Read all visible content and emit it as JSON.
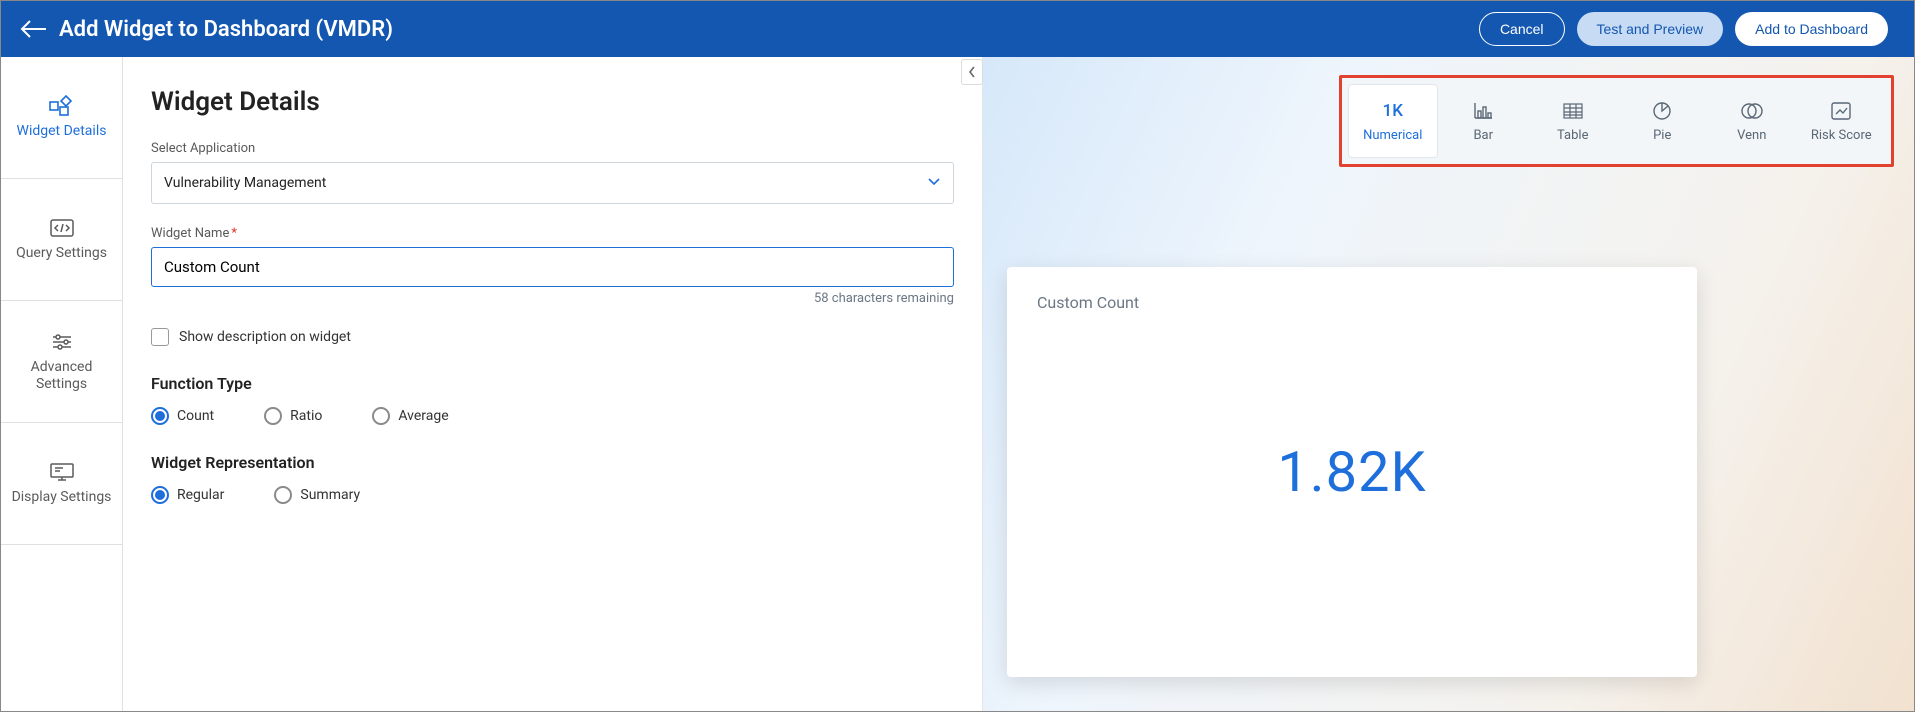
{
  "header": {
    "title": "Add Widget to Dashboard (VMDR)",
    "cancel": "Cancel",
    "test": "Test and Preview",
    "add": "Add to Dashboard"
  },
  "sidebar": {
    "items": [
      {
        "label": "Widget Details",
        "icon": "widget-tiles-icon"
      },
      {
        "label": "Query Settings",
        "icon": "code-icon"
      },
      {
        "label": "Advanced Settings",
        "icon": "sliders-icon"
      },
      {
        "label": "Display Settings",
        "icon": "display-icon"
      }
    ]
  },
  "form": {
    "heading": "Widget Details",
    "selectApp": {
      "label": "Select Application",
      "value": "Vulnerability Management"
    },
    "widgetName": {
      "label": "Widget Name",
      "value": "Custom Count",
      "helper": "58 characters remaining"
    },
    "showDesc": {
      "label": "Show description on widget"
    },
    "functionType": {
      "label": "Function Type",
      "options": [
        "Count",
        "Ratio",
        "Average"
      ],
      "selected": "Count"
    },
    "representation": {
      "label": "Widget Representation",
      "options": [
        "Regular",
        "Summary"
      ],
      "selected": "Regular"
    }
  },
  "types": {
    "items": [
      {
        "label": "Numerical",
        "icon": "1K"
      },
      {
        "label": "Bar"
      },
      {
        "label": "Table"
      },
      {
        "label": "Pie"
      },
      {
        "label": "Venn"
      },
      {
        "label": "Risk Score"
      }
    ],
    "selected": "Numerical"
  },
  "preview": {
    "title": "Custom Count",
    "value": "1.82K"
  }
}
